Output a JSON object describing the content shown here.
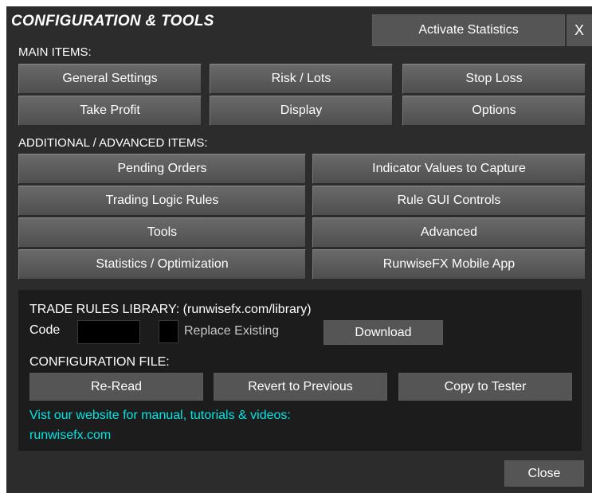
{
  "header": {
    "title": "CONFIGURATION & TOOLS",
    "activate_button": "Activate Statistics",
    "close_x": "X"
  },
  "main_items": {
    "label": "MAIN ITEMS:",
    "buttons": [
      "General Settings",
      "Risk / Lots",
      "Stop Loss",
      "Take Profit",
      "Display",
      "Options"
    ]
  },
  "advanced_items": {
    "label": "ADDITIONAL / ADVANCED ITEMS:",
    "buttons": [
      "Pending Orders",
      "Indicator Values to Capture",
      "Trading Logic Rules",
      "Rule GUI Controls",
      "Tools",
      "Advanced",
      "Statistics / Optimization",
      "RunwiseFX Mobile App"
    ]
  },
  "library": {
    "label": "TRADE RULES LIBRARY: (runwisefx.com/library)",
    "code_label": "Code",
    "code_value": "",
    "replace_label": "Replace Existing",
    "download_button": "Download"
  },
  "config_file": {
    "label": "CONFIGURATION FILE:",
    "buttons": [
      "Re-Read",
      "Revert to Previous",
      "Copy to Tester"
    ]
  },
  "website": {
    "text": "Vist our website for manual, tutorials & videos:",
    "link": "runwisefx.com"
  },
  "footer": {
    "close_button": "Close"
  },
  "colors": {
    "panel_bg": "#2c2c2c",
    "lower_bg": "#1c1c1c",
    "button_bg": "#5a5a5a",
    "link_color": "#00e5e5"
  }
}
